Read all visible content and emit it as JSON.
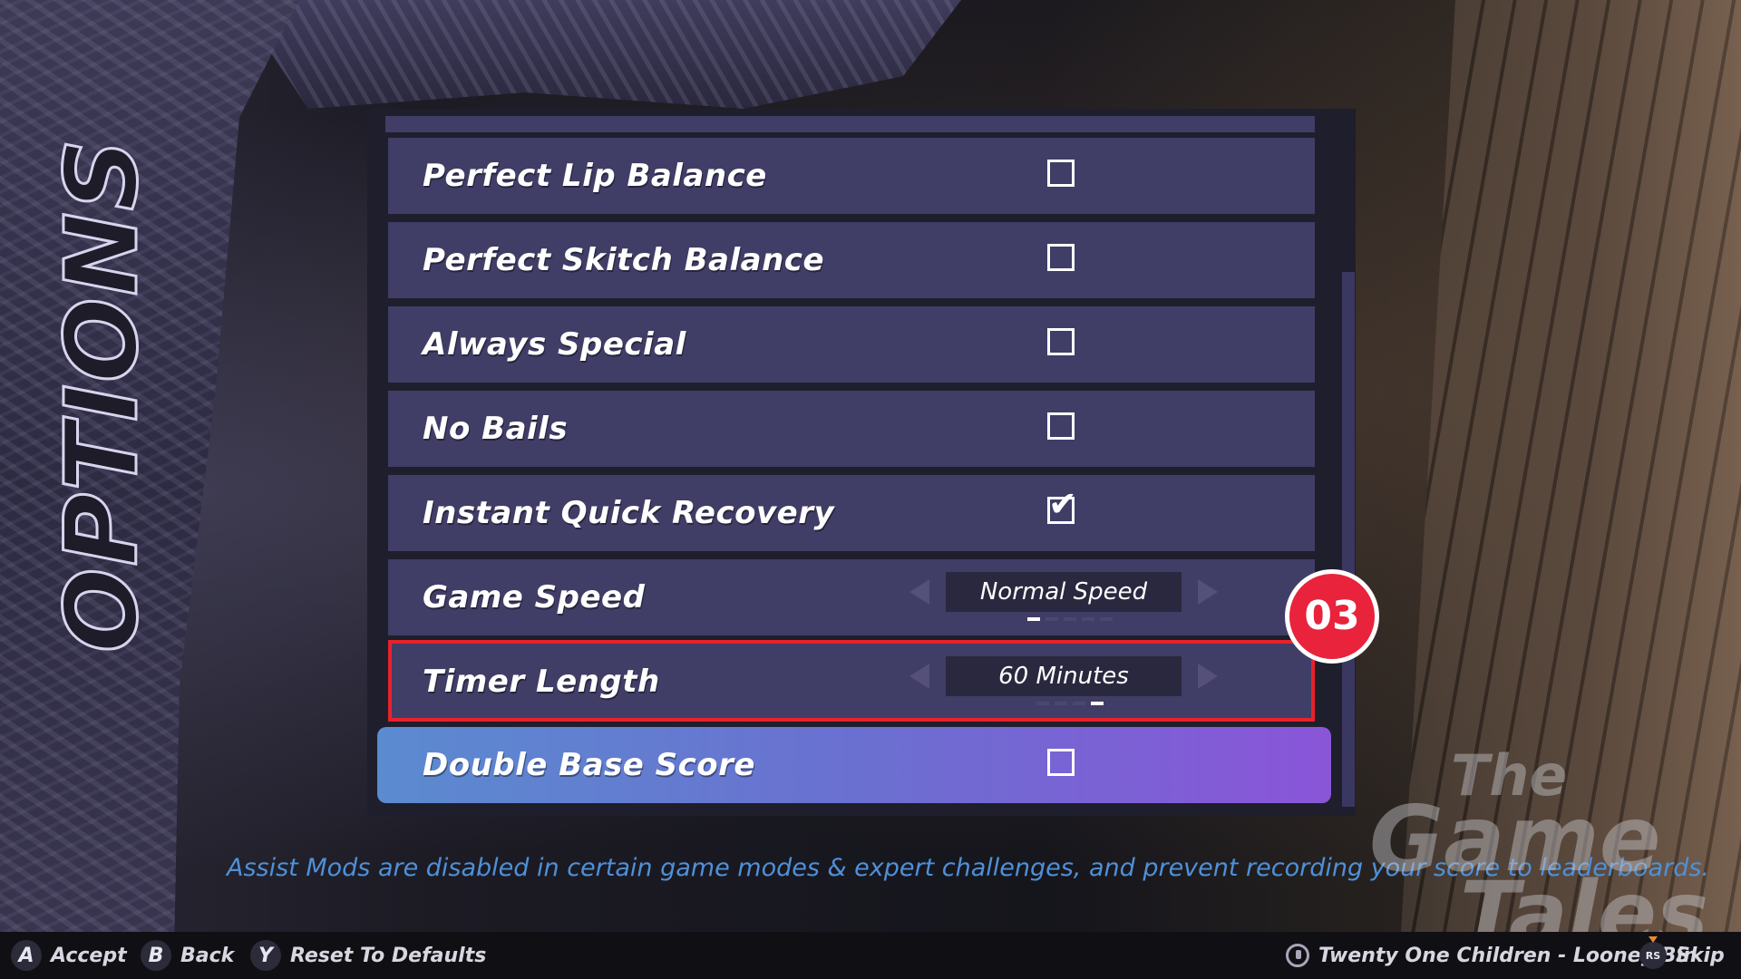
{
  "page_title": "OPTIONS",
  "options": [
    {
      "label": "Perfect Lip Balance",
      "type": "checkbox",
      "checked": false
    },
    {
      "label": "Perfect Skitch Balance",
      "type": "checkbox",
      "checked": false
    },
    {
      "label": "Always Special",
      "type": "checkbox",
      "checked": false
    },
    {
      "label": "No Bails",
      "type": "checkbox",
      "checked": false
    },
    {
      "label": "Instant Quick Recovery",
      "type": "checkbox",
      "checked": true
    },
    {
      "label": "Game Speed",
      "type": "selector",
      "value": "Normal Speed",
      "option_count": 5,
      "selected_index": 0
    },
    {
      "label": "Timer Length",
      "type": "selector",
      "value": "60 Minutes",
      "option_count": 4,
      "selected_index": 3
    },
    {
      "label": "Double Base Score",
      "type": "checkbox",
      "checked": false,
      "focused": true
    }
  ],
  "annotation_badge": "03",
  "info_text": "Assist Mods are disabled in certain game modes & expert challenges, and prevent recording your score to leaderboards.",
  "watermark": {
    "line1": "The",
    "line2": "Game",
    "line3": "Tales"
  },
  "controls": [
    {
      "button": "A",
      "label": "Accept"
    },
    {
      "button": "B",
      "label": "Back"
    },
    {
      "button": "Y",
      "label": "Reset To Defaults"
    }
  ],
  "now_playing": "Twenty One Children - Looney Bin",
  "skip": {
    "button": "RS",
    "label": "Skip"
  },
  "colors": {
    "row_bg": "#403d66",
    "focus_gradient_start": "#5b8bd0",
    "focus_gradient_end": "#8a55d8",
    "annotation_red": "#e8222b",
    "info_text": "#4f90d8"
  }
}
